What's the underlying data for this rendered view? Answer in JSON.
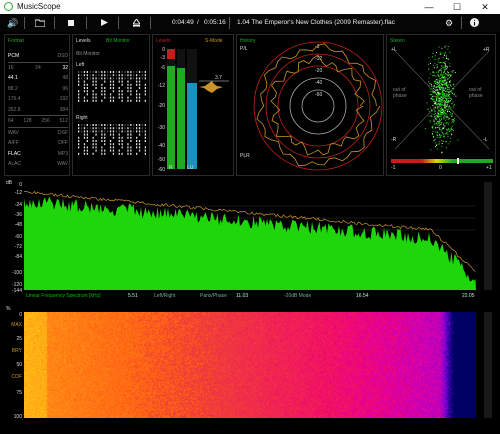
{
  "window": {
    "title": "MusicScope",
    "minimize": "—",
    "maximize": "☐",
    "close": "✕"
  },
  "toolbar": {
    "volume_icon": "volume-icon",
    "folder_icon": "folder-icon",
    "time_elapsed": "0:04:49",
    "time_separator": "/",
    "time_total": "0:05:16",
    "track": "1.04 The Emperor's New Clothes (2009 Remaster).flac"
  },
  "format": {
    "title": "Format",
    "rows": [
      [
        "PCM",
        "",
        "DSD"
      ],
      [
        "16",
        "24",
        "32"
      ],
      [
        "44.1",
        "",
        "48"
      ],
      [
        "88.2",
        "",
        "96"
      ],
      [
        "176.4",
        "",
        "192"
      ],
      [
        "352.8",
        "",
        "384"
      ],
      [
        "64",
        "128",
        "256",
        "512"
      ],
      [
        "WAV",
        "",
        "DSF"
      ],
      [
        "AIFF",
        "",
        "DFF"
      ],
      [
        "FLAC",
        "",
        "MP3"
      ],
      [
        "ALAC",
        "",
        "WAV"
      ]
    ]
  },
  "levels": {
    "title": "Levels",
    "mode": "Bit Monitor",
    "subtitle": "Bit Monitor",
    "left": "Left",
    "right": "Right",
    "scale_title": "Levels",
    "s_mode": "S-Mode",
    "scale": [
      "0",
      "-3",
      "-6",
      "-12",
      "-20",
      "-30",
      "-40",
      "-50",
      "-60"
    ],
    "peak": "3.7",
    "bar_labels": [
      "R",
      "LU"
    ],
    "left_fill": 0.86,
    "right_fill": 0.84,
    "lu_fill": 0.72
  },
  "history": {
    "title": "History",
    "pl": "P/L",
    "plr": "PLR",
    "ring_labels": [
      "-3",
      "-12",
      "-20",
      "-40",
      "-60"
    ]
  },
  "stereo": {
    "title": "Stereo",
    "corners": [
      "+L",
      "+R",
      "-R",
      "-L"
    ],
    "phase": [
      "out of phase",
      "out of phase"
    ],
    "meter": [
      "-1",
      "0",
      "+1"
    ]
  },
  "spectrum": {
    "db_label": "dB",
    "y_labels": [
      "0",
      "-12",
      "-24",
      "-36",
      "-48",
      "-60",
      "-72",
      "-84",
      "-100",
      "-120",
      "-144"
    ],
    "x_labels": [
      "Linear Frequency Spectrum [kHz]",
      "5.51",
      "Left/Right",
      "Pans/Phase",
      "11.03",
      "-20dB Mode",
      "16.54",
      "22.05"
    ]
  },
  "spectrogram": {
    "pct": "%",
    "y_labels": [
      "0",
      "MAX",
      "25",
      "BRY",
      "50",
      "COF",
      "75",
      "100"
    ]
  },
  "colors": {
    "accent": "#1faa1f",
    "spectrum": "#1ed60a",
    "gold": "#c8932a",
    "red": "#c0201a"
  }
}
